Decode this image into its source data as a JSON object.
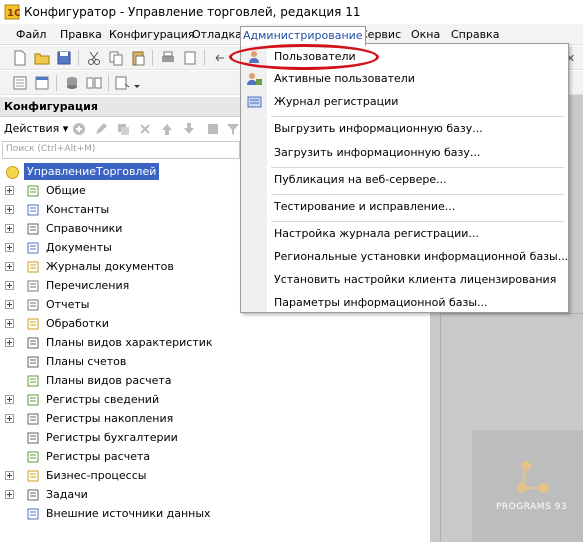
{
  "window": {
    "title": "Конфигуратор - Управление торговлей, редакция 11"
  },
  "menubar": {
    "items": [
      {
        "label": "Файл"
      },
      {
        "label": "Правка"
      },
      {
        "label": "Конфигурация"
      },
      {
        "label": "Отладка"
      },
      {
        "label": "Администрирование"
      },
      {
        "label": "Сервис"
      },
      {
        "label": "Окна"
      },
      {
        "label": "Справка"
      }
    ]
  },
  "config_panel": {
    "title": "Конфигурация",
    "actions_label": "Действия",
    "search_placeholder": "Поиск (Ctrl+Alt+M)",
    "root": "УправлениеТорговлей",
    "items": [
      {
        "label": "Общие",
        "icon": "common-icon"
      },
      {
        "label": "Константы",
        "icon": "constants-icon"
      },
      {
        "label": "Справочники",
        "icon": "catalogs-icon"
      },
      {
        "label": "Документы",
        "icon": "documents-icon"
      },
      {
        "label": "Журналы документов",
        "icon": "journals-icon"
      },
      {
        "label": "Перечисления",
        "icon": "enums-icon"
      },
      {
        "label": "Отчеты",
        "icon": "reports-icon"
      },
      {
        "label": "Обработки",
        "icon": "processing-icon"
      },
      {
        "label": "Планы видов характеристик",
        "icon": "char-plans-icon"
      },
      {
        "label": "Планы счетов",
        "icon": "chart-of-accounts-icon"
      },
      {
        "label": "Планы видов расчета",
        "icon": "calc-plans-icon"
      },
      {
        "label": "Регистры сведений",
        "icon": "info-registers-icon"
      },
      {
        "label": "Регистры накопления",
        "icon": "accum-registers-icon"
      },
      {
        "label": "Регистры бухгалтерии",
        "icon": "accounting-registers-icon"
      },
      {
        "label": "Регистры расчета",
        "icon": "calc-registers-icon"
      },
      {
        "label": "Бизнес-процессы",
        "icon": "business-process-icon"
      },
      {
        "label": "Задачи",
        "icon": "tasks-icon"
      },
      {
        "label": "Внешние источники данных",
        "icon": "external-sources-icon"
      }
    ]
  },
  "admin_menu": {
    "items": [
      {
        "label": "Пользователи",
        "icon": "user-icon"
      },
      {
        "label": "Активные пользователи",
        "icon": "active-users-icon"
      },
      {
        "label": "Журнал регистрации",
        "icon": "log-icon"
      },
      {
        "label": "Выгрузить информационную базу..."
      },
      {
        "label": "Загрузить информационную базу..."
      },
      {
        "label": "Публикация на веб-сервере..."
      },
      {
        "label": "Тестирование и исправление..."
      },
      {
        "label": "Настройка журнала регистрации..."
      },
      {
        "label": "Региональные установки информационной базы..."
      },
      {
        "label": "Установить настройки клиента лицензирования"
      },
      {
        "label": "Параметры информационной базы..."
      }
    ]
  },
  "watermark": {
    "text": "PROGRAMS 93"
  },
  "colors": {
    "selection": "#3a63c4",
    "highlight_ellipse": "#d0121b",
    "menu_active_text": "#1f4fa3"
  }
}
